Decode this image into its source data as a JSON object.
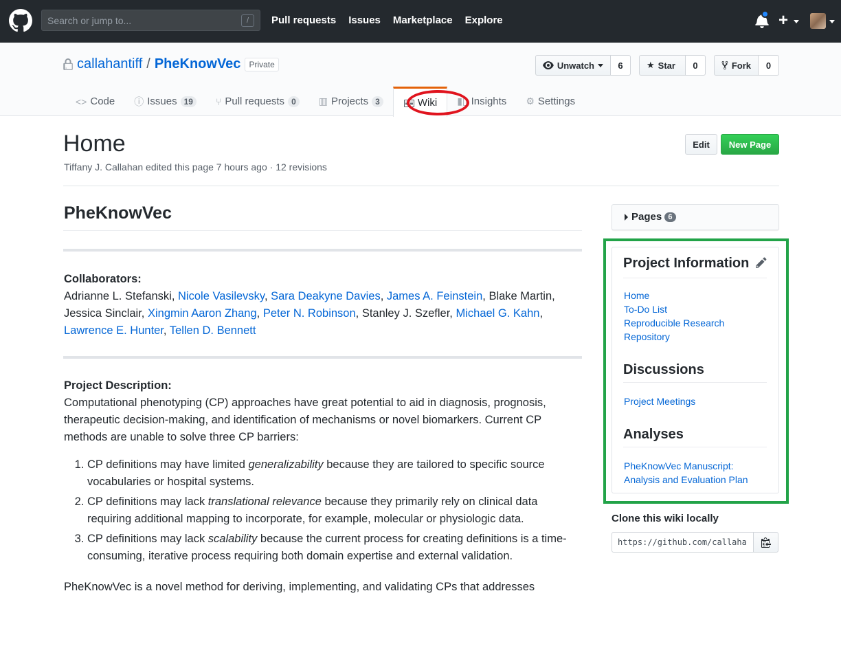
{
  "header": {
    "search_placeholder": "Search or jump to...",
    "search_shortcut": "/",
    "nav": [
      "Pull requests",
      "Issues",
      "Marketplace",
      "Explore"
    ],
    "plus": "+"
  },
  "repo": {
    "owner": "callahantiff",
    "separator": "/",
    "name": "PheKnowVec",
    "visibility": "Private",
    "unwatch_label": "Unwatch",
    "watch_count": "6",
    "star_label": "Star",
    "star_count": "0",
    "fork_label": "Fork",
    "fork_count": "0"
  },
  "tabs": [
    {
      "label": "Code",
      "count": ""
    },
    {
      "label": "Issues",
      "count": "19"
    },
    {
      "label": "Pull requests",
      "count": "0"
    },
    {
      "label": "Projects",
      "count": "3"
    },
    {
      "label": "Wiki",
      "count": ""
    },
    {
      "label": "Insights",
      "count": ""
    },
    {
      "label": "Settings",
      "count": ""
    }
  ],
  "page": {
    "title": "Home",
    "meta": "Tiffany J. Callahan edited this page 7 hours ago · 12 revisions",
    "edit_label": "Edit",
    "new_page_label": "New Page"
  },
  "content": {
    "heading": "PheKnowVec",
    "collaborators_label": "Collaborators:",
    "collab_parts": [
      {
        "text": "Adrianne L. Stefanski, ",
        "link": false
      },
      {
        "text": "Nicole Vasilevsky",
        "link": true
      },
      {
        "text": ", ",
        "link": false
      },
      {
        "text": "Sara Deakyne Davies",
        "link": true
      },
      {
        "text": ", ",
        "link": false
      },
      {
        "text": "James A. Feinstein",
        "link": true
      },
      {
        "text": ", Blake Martin, Jessica Sinclair, ",
        "link": false
      },
      {
        "text": "Xingmin Aaron Zhang",
        "link": true
      },
      {
        "text": ", ",
        "link": false
      },
      {
        "text": "Peter N. Robinson",
        "link": true
      },
      {
        "text": ", Stanley J. Szefler, ",
        "link": false
      },
      {
        "text": "Michael G. Kahn",
        "link": true
      },
      {
        "text": ", ",
        "link": false
      },
      {
        "text": "Lawrence E. Hunter",
        "link": true
      },
      {
        "text": ", ",
        "link": false
      },
      {
        "text": "Tellen D. Bennett",
        "link": true
      }
    ],
    "description_label": "Project Description:",
    "description": "Computational phenotyping (CP) approaches have great potential to aid in diagnosis, prognosis, therapeutic decision-making, and identification of mechanisms or novel biomarkers. Current CP methods are unable to solve three CP barriers:",
    "barriers": [
      {
        "pre": "CP definitions may have limited ",
        "em": "generalizability",
        "post": " because they are tailored to specific source vocabularies or hospital systems."
      },
      {
        "pre": "CP definitions may lack ",
        "em": "translational relevance",
        "post": " because they primarily rely on clinical data requiring additional mapping to incorporate, for example, molecular or physiologic data."
      },
      {
        "pre": "CP definitions may lack ",
        "em": "scalability",
        "post": " because the current process for creating definitions is a time-consuming, iterative process requiring both domain expertise and external validation."
      }
    ],
    "closing": "PheKnowVec is a novel method for deriving, implementing, and validating CPs that addresses"
  },
  "sidebar": {
    "pages_label": "Pages",
    "pages_count": "6",
    "project_info_title": "Project Information",
    "project_links": [
      "Home",
      "To-Do List",
      "Reproducible Research",
      "Repository"
    ],
    "discussions_title": "Discussions",
    "discussion_links": [
      "Project Meetings"
    ],
    "analyses_title": "Analyses",
    "analyses_links": [
      "PheKnowVec Manuscript:",
      "Analysis and Evaluation Plan"
    ],
    "clone_label": "Clone this wiki locally",
    "clone_url": "https://github.com/callahantiff/PheKnowVec.wiki.git"
  },
  "colors": {
    "header_bg": "#24292e",
    "link": "#0366d6",
    "primary_green": "#28a745",
    "annotation_red": "#e0141e",
    "annotation_green": "#22a348",
    "notification_blue": "#2188ff"
  }
}
